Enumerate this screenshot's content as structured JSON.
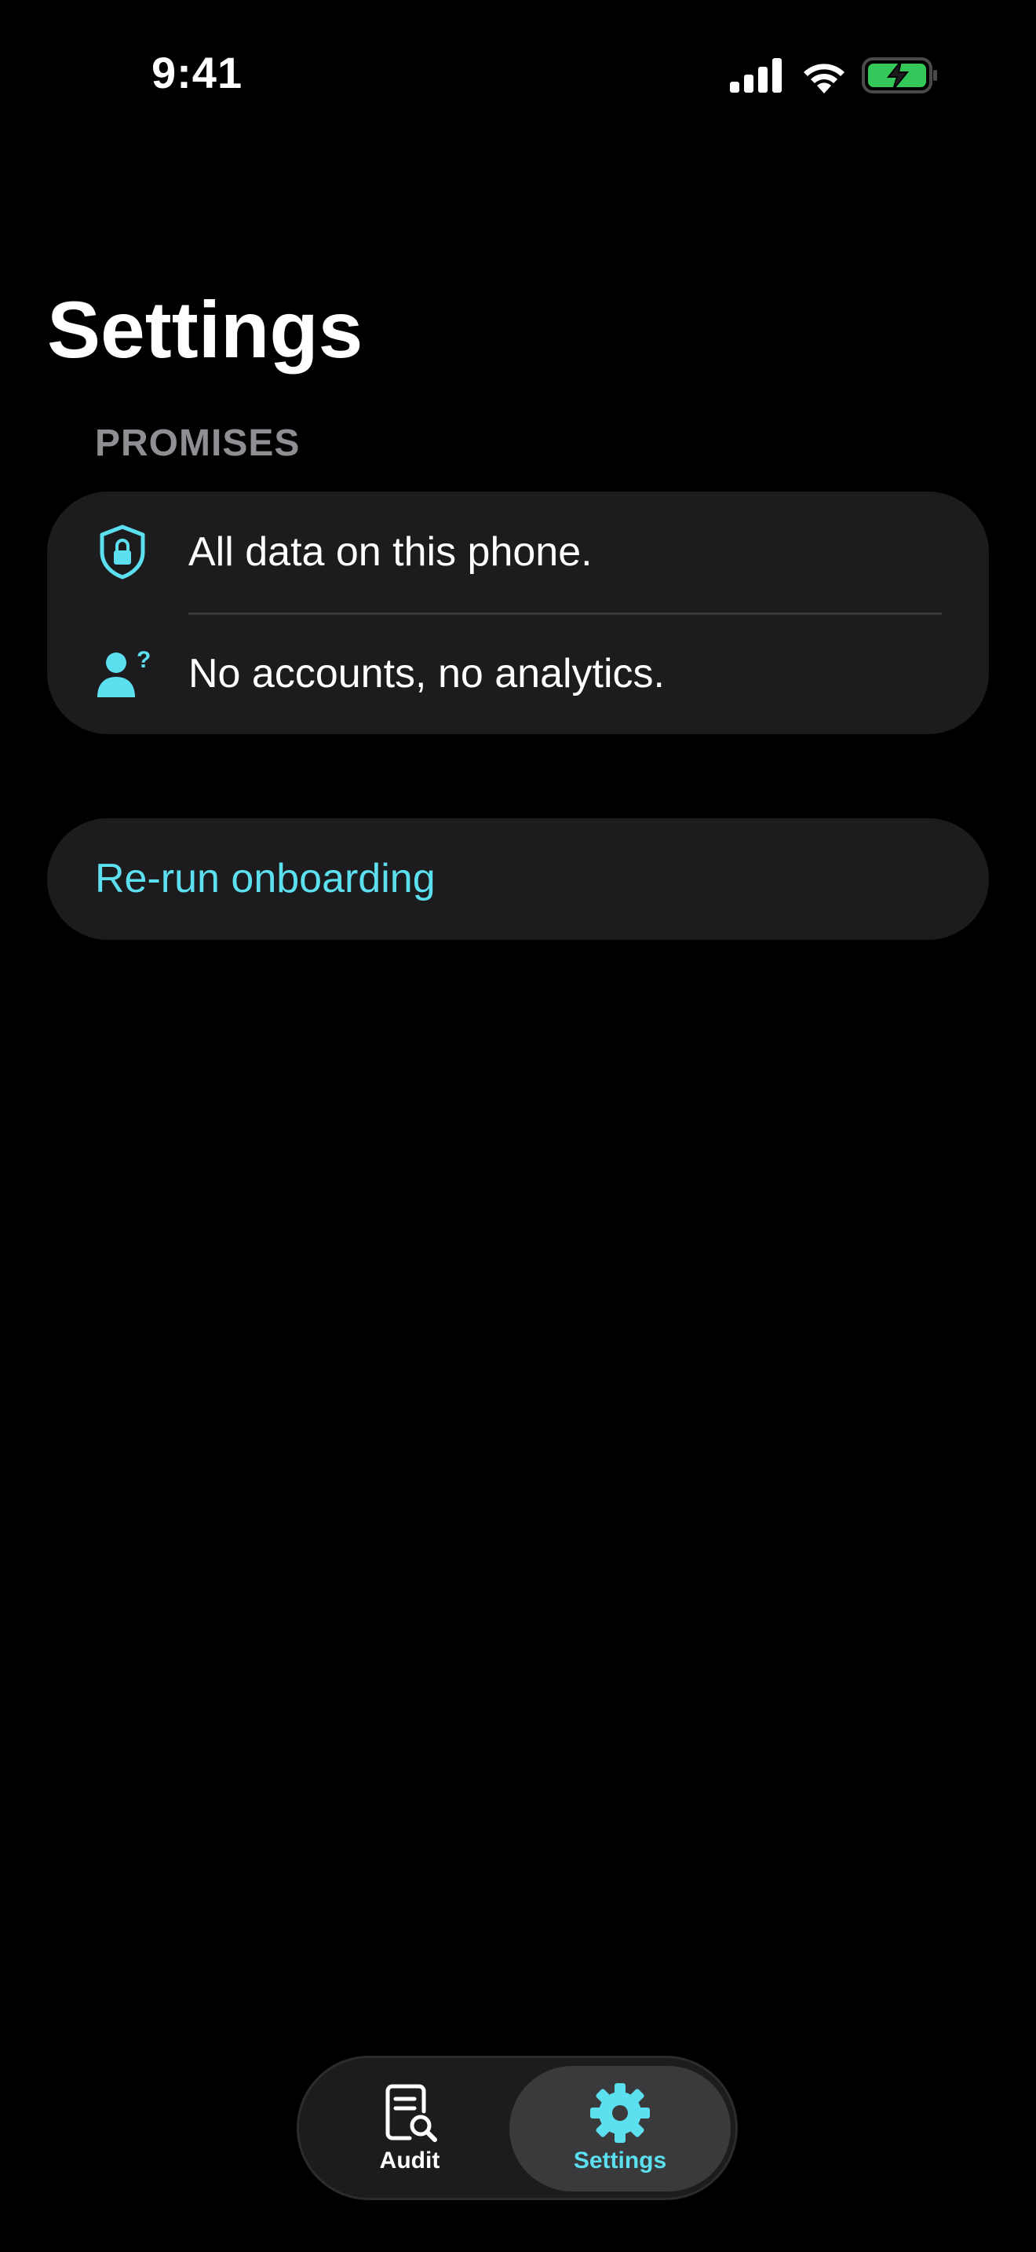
{
  "status_bar": {
    "time": "9:41"
  },
  "page": {
    "title": "Settings"
  },
  "promises": {
    "header": "PROMISES",
    "items": [
      {
        "label": "All data on this phone.",
        "icon": "lock-shield-icon"
      },
      {
        "label": "No accounts, no analytics.",
        "icon": "person-question-icon"
      }
    ]
  },
  "actions": {
    "rerun_onboarding": "Re-run onboarding"
  },
  "tab_bar": {
    "tabs": [
      {
        "label": "Audit",
        "icon": "document-search-icon",
        "selected": false
      },
      {
        "label": "Settings",
        "icon": "gear-icon",
        "selected": true
      }
    ]
  },
  "colors": {
    "accent": "#5ce0f0",
    "background": "#000000",
    "card": "#1c1c1e",
    "secondary_text": "#8e8e93"
  }
}
